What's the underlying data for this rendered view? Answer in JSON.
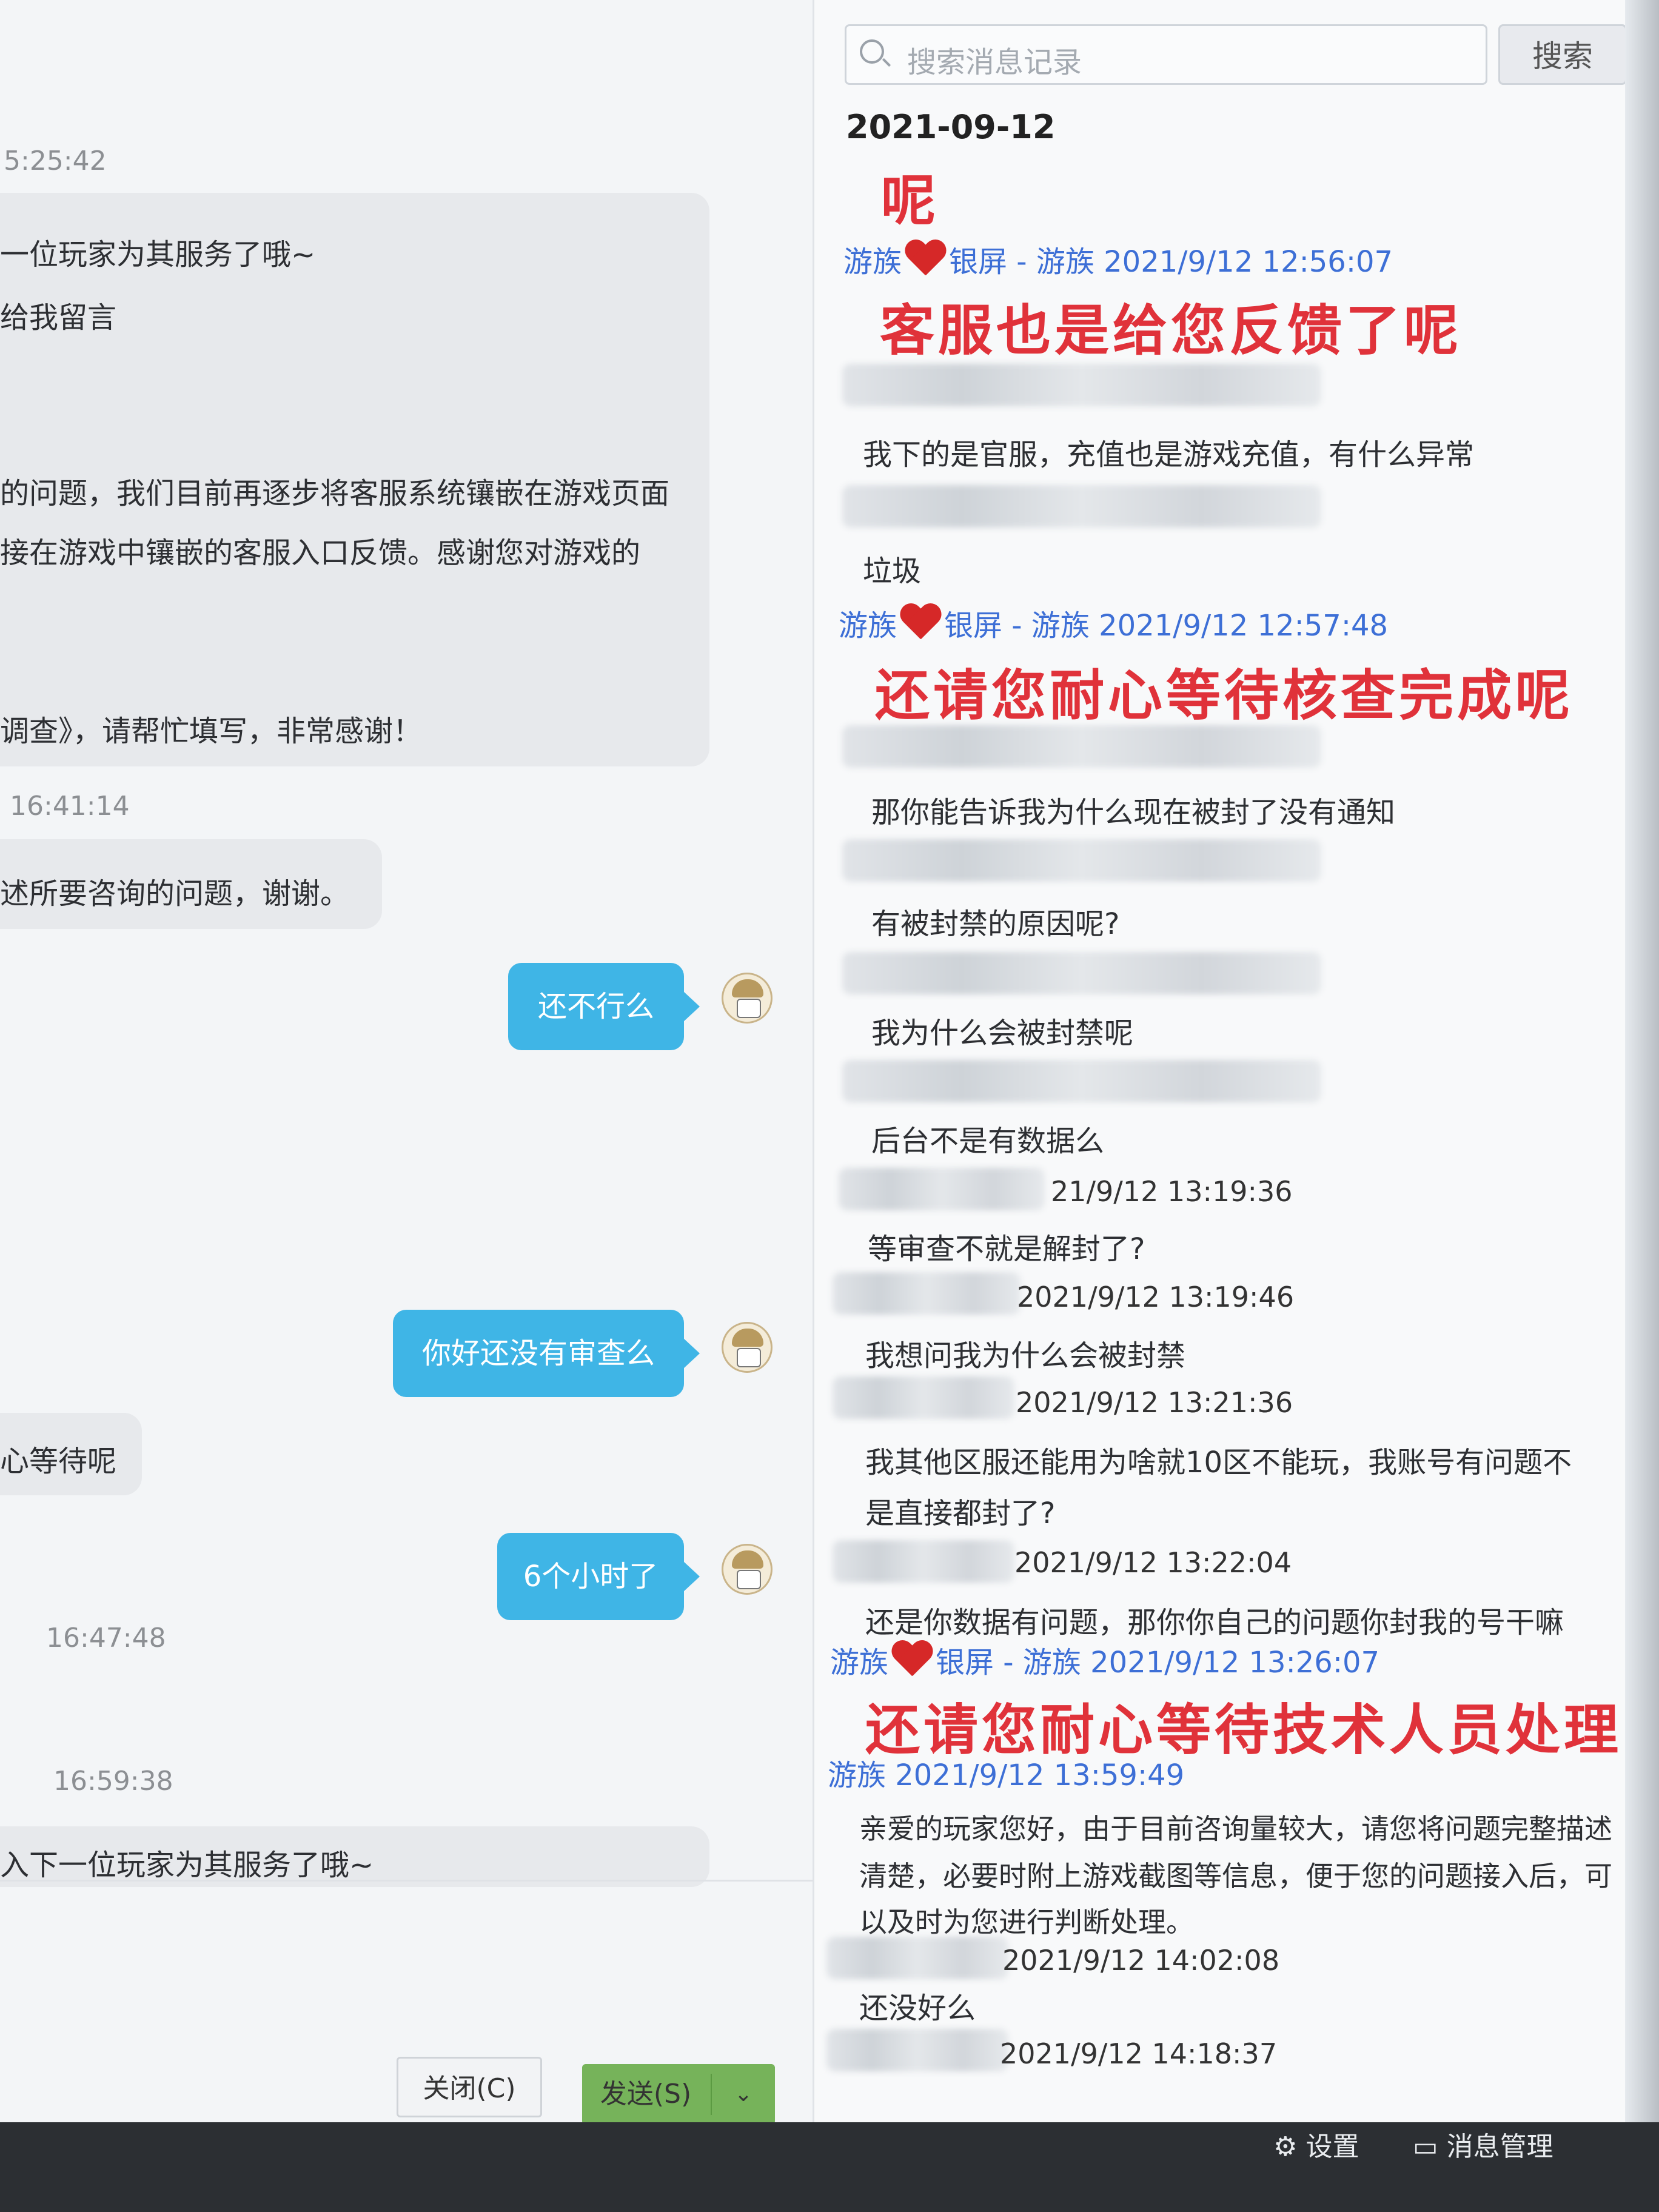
{
  "left_chat": {
    "ts1": "5:25:42",
    "line1": "一位玩家为其服务了哦~",
    "line2": "给我留言",
    "line3": "的问题，我们目前再逐步将客服系统镶嵌在游戏页面",
    "line4": "接在游戏中镶嵌的客服入口反馈。感谢您对游戏的",
    "line5": "调查》，请帮忙填写，非常感谢！",
    "ts2": "16:41:14",
    "line6": "述所要咨询的问题，谢谢。",
    "bubble1": "还不行么",
    "bubble2": "你好还没有审查么",
    "line7": "心等待呢",
    "bubble3": "6个小时了",
    "ts3": "16:47:48",
    "ts4": "16:59:38",
    "line8": "入下一位玩家为其服务了哦~",
    "close_button": "关闭(C)",
    "send_button": "发送(S)",
    "send_dropdown": "⌄"
  },
  "history": {
    "search_placeholder": "搜索消息记录",
    "search_button": "搜索",
    "date": "2021-09-12",
    "red1": "呢",
    "agent1_pre": "游族",
    "agent1_post": "银屏 - 游族 2021/9/12 12:56:07",
    "red2": "客服也是给您反馈了呢",
    "msg1": "我下的是官服，充值也是游戏充值，有什么异常",
    "msg2": "垃圾",
    "agent2_pre": "游族",
    "agent2_post": "银屏 - 游族 2021/9/12 12:57:48",
    "red3": "还请您耐心等待核查完成呢",
    "msg3": "那你能告诉我为什么现在被封了没有通知",
    "msg4": "有被封禁的原因呢?",
    "msg5": "我为什么会被封禁呢",
    "msg6": "后台不是有数据么",
    "t1": "21/9/12 13:19:36",
    "msg7": "等审查不就是解封了?",
    "t2": "2021/9/12 13:19:46",
    "msg8": "我想问我为什么会被封禁",
    "t3": "2021/9/12 13:21:36",
    "msg9a": "我其他区服还能用为啥就10区不能玩，我账号有问题不",
    "msg9b": "是直接都封了?",
    "t4": "2021/9/12 13:22:04",
    "msg10": "还是你数据有问题，那你你自己的问题你封我的号干嘛",
    "agent3_pre": "游族",
    "agent3_post": "银屏 - 游族 2021/9/12 13:26:07",
    "red4": "还请您耐心等待技术人员处理",
    "agent4": "游族 2021/9/12 13:59:49",
    "msg11a": "亲爱的玩家您好，由于目前咨询量较大，请您将问题完整描述",
    "msg11b": "清楚，必要时附上游戏截图等信息，便于您的问题接入后，可",
    "msg11c": "以及时为您进行判断处理。",
    "t5": "2021/9/12 14:02:08",
    "msg12": "还没好么",
    "t6": "2021/9/12 14:18:37",
    "settings": "设置",
    "msg_manage": "消息管理"
  }
}
